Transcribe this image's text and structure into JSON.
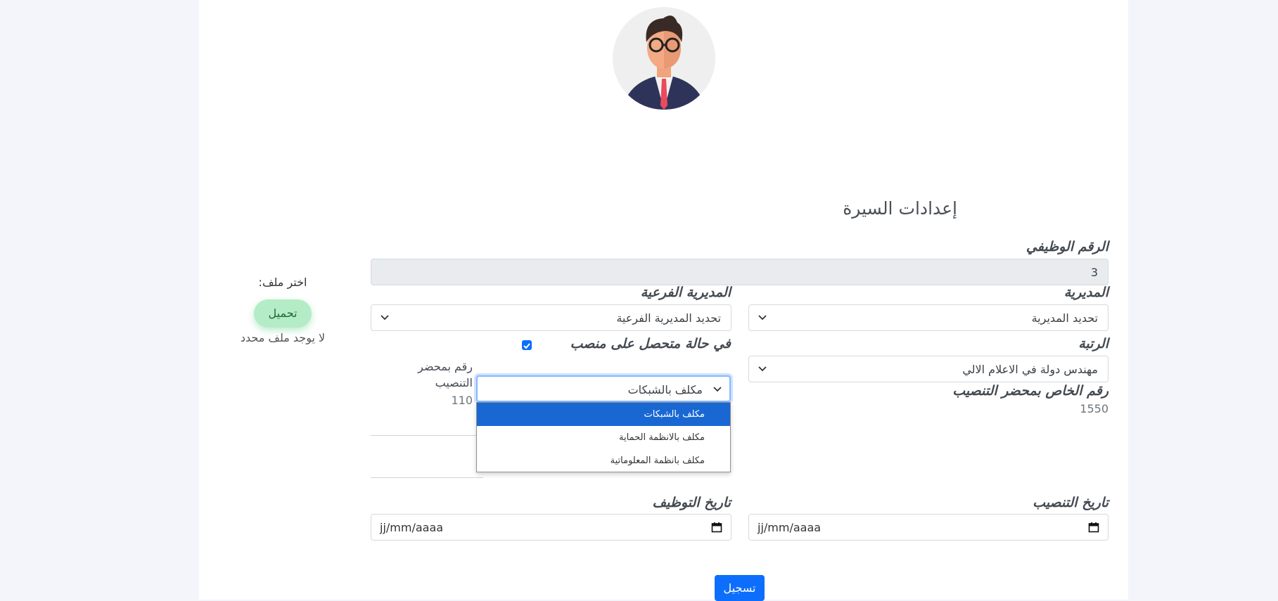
{
  "profile_settings": {
    "title": "إعدادات السيرة",
    "employee_id": {
      "label": "الرقم الوظيفي",
      "value": "3"
    },
    "directorate": {
      "label": "المديرية",
      "value": "تحديد المديرية"
    },
    "sub_directorate": {
      "label": "المديرية الفرعية",
      "value": "تحديد المديرية الفرعية"
    },
    "grade": {
      "label": "الرتبة",
      "value": "مهندس دولة في الاعلام الالي"
    },
    "position_checkbox": {
      "label": "في حالة متحصل على منصب",
      "checked": true
    },
    "position_select": {
      "value": "مكلف بالشبكات",
      "options": [
        "مكلف بالشبكات",
        "مكلف بالانظمة الحماية",
        "مكلف بانظمة المعلوماتية"
      ],
      "selected_index": 0
    },
    "appointment_record_number": {
      "label_line1": "رقم بمحضر",
      "label_line2": "التنصيب",
      "value": "110"
    },
    "special_record_number": {
      "label": "رقم الخاص بمحضر التنصيب",
      "value": "1550"
    },
    "appointment_date": {
      "label": "تاريخ التنصيب",
      "placeholder": "jj/mm/aaaa"
    },
    "hiring_date": {
      "label": "تاريخ التوظيف",
      "placeholder": "jj/mm/aaaa"
    },
    "submit_label": "تسجيل"
  },
  "upload": {
    "choose_file_label": "اختر ملف:",
    "upload_button_label": "تحميل",
    "no_file_text": "لا يوجد ملف محدد"
  },
  "colors": {
    "primary": "#0d6efd",
    "upload_bg": "#b4ecc7",
    "selected_option": "#1967d2"
  }
}
